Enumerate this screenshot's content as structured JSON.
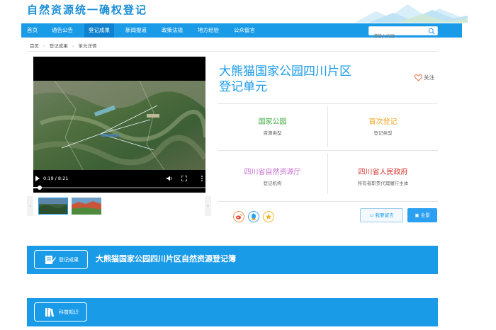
{
  "header": {
    "site_title": "自然资源统一确权登记"
  },
  "nav": {
    "items": [
      {
        "label": "首页"
      },
      {
        "label": "通告公告"
      },
      {
        "label": "登记成果"
      },
      {
        "label": "新闻报道"
      },
      {
        "label": "政策法规"
      },
      {
        "label": "地方经验"
      },
      {
        "label": "公众留言"
      }
    ],
    "active_index": 2,
    "search_placeholder": "请输入内容"
  },
  "breadcrumb": [
    "首页",
    "登记成果",
    "单元详情"
  ],
  "video": {
    "time": "0:19 / 8:21",
    "progress": 0.038
  },
  "unit": {
    "title_line1": "大熊猫国家公园四川片区",
    "title_line2": "登记单元",
    "follow_label": "关注",
    "fields": [
      {
        "value": "国家公园",
        "key": "资源类型",
        "color": "#3caa3c"
      },
      {
        "value": "首次登记",
        "key": "登记类型",
        "color": "#f5a623"
      },
      {
        "value": "四川省自然资源厅",
        "key": "登记机构",
        "color": "#c46fd0"
      },
      {
        "value": "四川省人民政府",
        "key": "所有者职责代理履行主体",
        "color": "#d9302c"
      }
    ],
    "message_button": "我要留言",
    "full_button": "全景"
  },
  "banners": {
    "results_tag": "登记成果",
    "results_title": "大熊猫国家公园四川片区自然资源登记簿",
    "knowledge_tag": "科普知识"
  },
  "colors": {
    "primary": "#1a9be8",
    "nav_active": "#0f82cf"
  }
}
